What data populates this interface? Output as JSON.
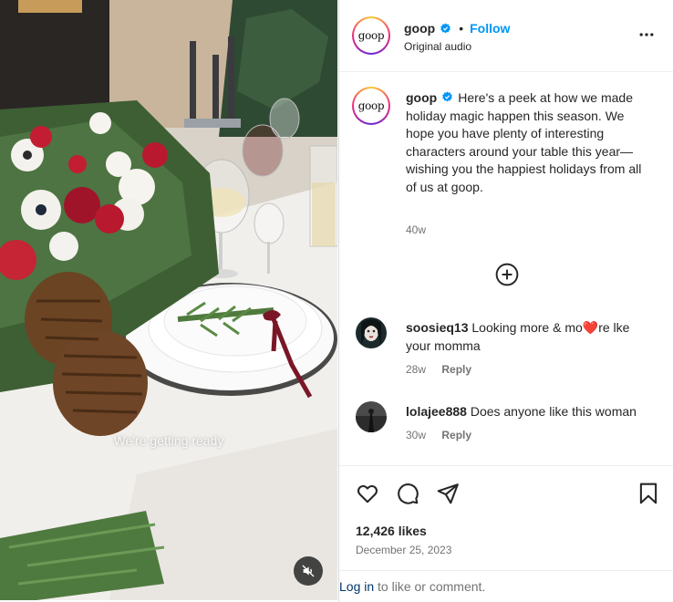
{
  "media": {
    "overlay_text": "We're getting ready",
    "mute_icon": "speaker-muted-icon"
  },
  "header": {
    "username": "goop",
    "avatar_text": "goop",
    "separator": "•",
    "follow_label": "Follow",
    "subtitle": "Original audio",
    "more_icon": "more-horizontal-icon"
  },
  "caption": {
    "username": "goop",
    "avatar_text": "goop",
    "text": "Here's a peek at how we made holiday magic happen this season. We hope you have plenty of interesting characters around your table this year—wishing you the happiest holidays from all of us at goop.",
    "time": "40w"
  },
  "load_more_icon": "plus-circle-icon",
  "comments": [
    {
      "username": "soosieq13",
      "text_before": "Looking more & mo",
      "emoji": "❤️",
      "text_after": "re lke your momma",
      "time": "28w",
      "reply_label": "Reply"
    },
    {
      "username": "lolajee888",
      "text": "Does anyone like this woman",
      "time": "30w",
      "reply_label": "Reply"
    }
  ],
  "actions": {
    "like_icon": "heart-icon",
    "comment_icon": "comment-icon",
    "share_icon": "share-icon",
    "save_icon": "bookmark-icon"
  },
  "likes": "12,426 likes",
  "date": "December 25, 2023",
  "footer": {
    "login_label": "Log in",
    "rest": " to like or comment."
  },
  "colors": {
    "link_blue": "#0095f6",
    "muted_text": "#737373",
    "heart_red": "#e0245e"
  }
}
